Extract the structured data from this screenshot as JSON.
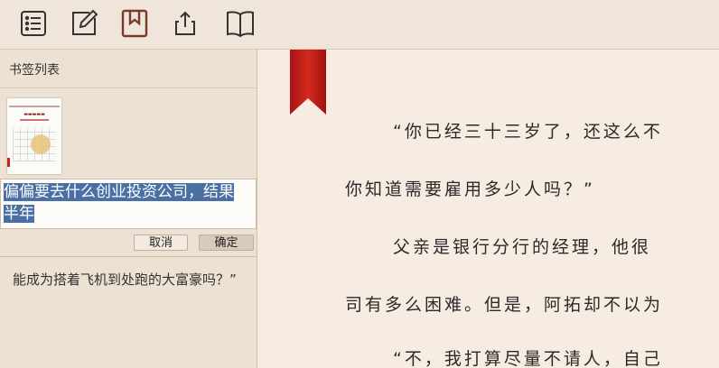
{
  "toolbar": {
    "icons": [
      "list-icon",
      "edit-icon",
      "bookmark-icon",
      "share-icon",
      "book-open-icon"
    ]
  },
  "sidebar": {
    "title": "书签列表",
    "edit_text": "偏偏要去什么创业投资公司，结果半年",
    "cancel_label": "取消",
    "ok_label": "确定",
    "note_text": "能成为搭着飞机到处跑的大富豪吗？”"
  },
  "content": {
    "lines": [
      "“你已经三十三岁了，还这么不",
      "你知道需要雇用多少人吗？”",
      "父亲是银行分行的经理，他很",
      "司有多么困难。但是，阿拓却不以为",
      "“不，我打算尽量不请人，自己"
    ]
  },
  "colors": {
    "bookmark_ribbon": "#c81e1e",
    "selection": "#4a6fa5",
    "active_icon": "#7a3b2a"
  }
}
